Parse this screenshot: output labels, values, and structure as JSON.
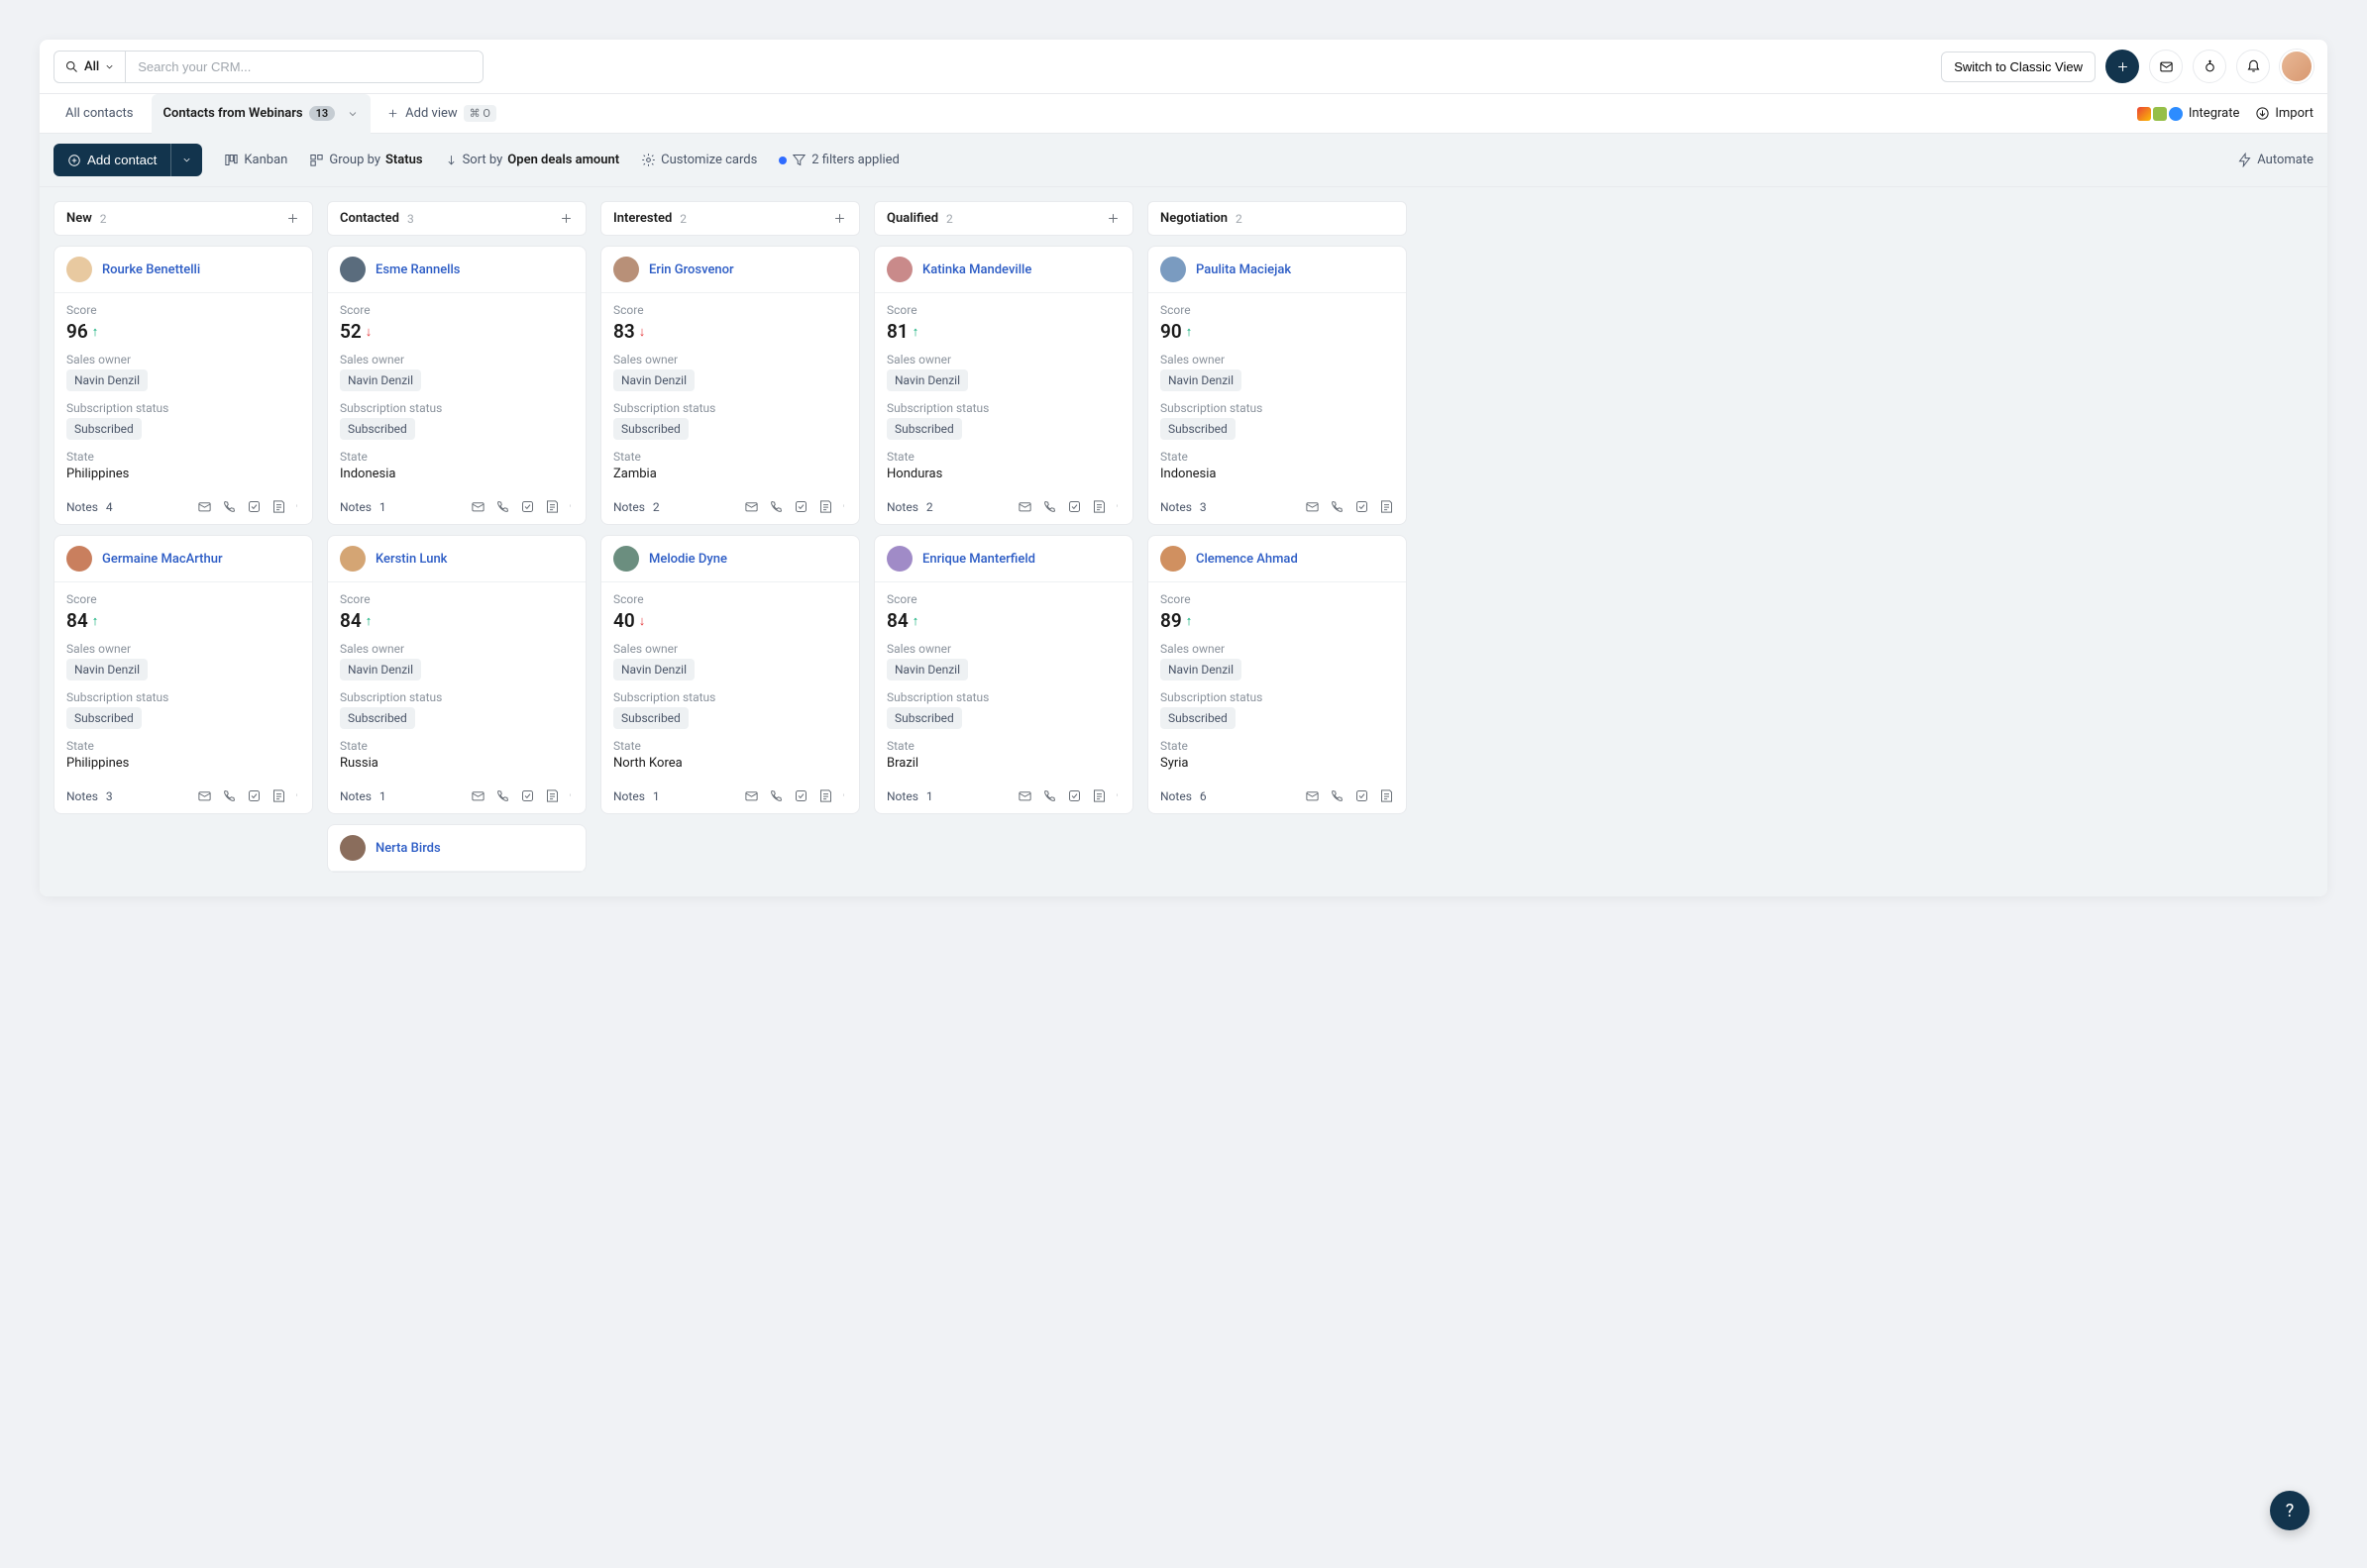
{
  "topbar": {
    "scope_label": "All",
    "search_placeholder": "Search your CRM...",
    "switch_view_label": "Switch to Classic View"
  },
  "tabs": {
    "all_contacts": "All contacts",
    "active_tab": "Contacts from Webinars",
    "active_count": "13",
    "add_view": "Add view",
    "add_view_shortcut": "⌘ O",
    "integrate_label": "Integrate",
    "import_label": "Import"
  },
  "toolbar": {
    "add_contact": "Add contact",
    "kanban": "Kanban",
    "group_by_label": "Group by",
    "group_by_value": "Status",
    "sort_by_label": "Sort by",
    "sort_by_value": "Open deals amount",
    "customize_cards": "Customize cards",
    "filters_applied": "2 filters applied",
    "automate": "Automate"
  },
  "field_labels": {
    "score": "Score",
    "sales_owner": "Sales owner",
    "subscription_status": "Subscription status",
    "state": "State",
    "notes": "Notes"
  },
  "columns": [
    {
      "title": "New",
      "count": "2",
      "cards": [
        {
          "name": "Rourke Benettelli",
          "score": "96",
          "trend": "up",
          "owner": "Navin Denzil",
          "sub": "Subscribed",
          "state": "Philippines",
          "notes": "4"
        },
        {
          "name": "Germaine MacArthur",
          "score": "84",
          "trend": "up",
          "owner": "Navin Denzil",
          "sub": "Subscribed",
          "state": "Philippines",
          "notes": "3"
        }
      ]
    },
    {
      "title": "Contacted",
      "count": "3",
      "cards": [
        {
          "name": "Esme Rannells",
          "score": "52",
          "trend": "down",
          "owner": "Navin Denzil",
          "sub": "Subscribed",
          "state": "Indonesia",
          "notes": "1"
        },
        {
          "name": "Kerstin Lunk",
          "score": "84",
          "trend": "up",
          "owner": "Navin Denzil",
          "sub": "Subscribed",
          "state": "Russia",
          "notes": "1"
        },
        {
          "name": "Nerta Birds",
          "score": "",
          "trend": "",
          "owner": "",
          "sub": "",
          "state": "",
          "notes": ""
        }
      ]
    },
    {
      "title": "Interested",
      "count": "2",
      "cards": [
        {
          "name": "Erin Grosvenor",
          "score": "83",
          "trend": "down",
          "owner": "Navin Denzil",
          "sub": "Subscribed",
          "state": "Zambia",
          "notes": "2"
        },
        {
          "name": "Melodie Dyne",
          "score": "40",
          "trend": "down",
          "owner": "Navin Denzil",
          "sub": "Subscribed",
          "state": "North Korea",
          "notes": "1"
        }
      ]
    },
    {
      "title": "Qualified",
      "count": "2",
      "cards": [
        {
          "name": "Katinka Mandeville",
          "score": "81",
          "trend": "up",
          "owner": "Navin Denzil",
          "sub": "Subscribed",
          "state": "Honduras",
          "notes": "2"
        },
        {
          "name": "Enrique Manterfield",
          "score": "84",
          "trend": "up",
          "owner": "Navin Denzil",
          "sub": "Subscribed",
          "state": "Brazil",
          "notes": "1"
        }
      ]
    },
    {
      "title": "Negotiation",
      "count": "2",
      "cards": [
        {
          "name": "Paulita Maciejak",
          "score": "90",
          "trend": "up",
          "owner": "Navin Denzil",
          "sub": "Subscribed",
          "state": "Indonesia",
          "notes": "3"
        },
        {
          "name": "Clemence Ahmad",
          "score": "89",
          "trend": "up",
          "owner": "Navin Denzil",
          "sub": "Subscribed",
          "state": "Syria",
          "notes": "6"
        }
      ]
    }
  ],
  "avatar_colors": [
    "#e8c9a0",
    "#c97f5e",
    "#5a6c7d",
    "#d4a574",
    "#8a6d5c",
    "#b89078",
    "#6b8e7f",
    "#c98a8a",
    "#a08bc7",
    "#7a9bc0",
    "#d09060"
  ]
}
